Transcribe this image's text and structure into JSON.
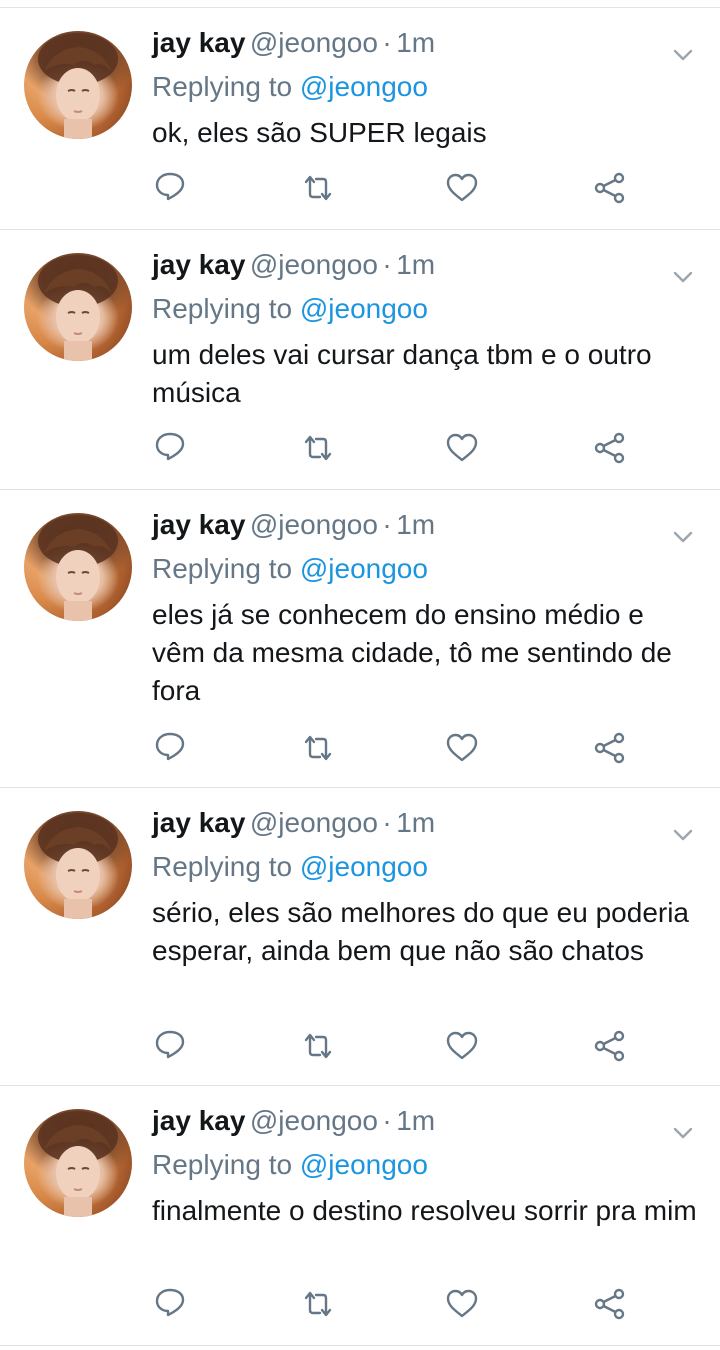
{
  "tweets": [
    {
      "author_name": "jay kay",
      "author_handle": "@jeongoo",
      "separator": "·",
      "time": "1m",
      "reply_prefix": "Replying to",
      "reply_mention": "@jeongoo",
      "text": "ok, eles são SUPER legais"
    },
    {
      "author_name": "jay kay",
      "author_handle": "@jeongoo",
      "separator": "·",
      "time": "1m",
      "reply_prefix": "Replying to",
      "reply_mention": "@jeongoo",
      "text": "um deles vai cursar dança tbm e o outro música"
    },
    {
      "author_name": "jay kay",
      "author_handle": "@jeongoo",
      "separator": "·",
      "time": "1m",
      "reply_prefix": "Replying to",
      "reply_mention": "@jeongoo",
      "text": "eles já se conhecem do ensino médio e vêm da mesma cidade, tô me sentindo de fora"
    },
    {
      "author_name": "jay kay",
      "author_handle": "@jeongoo",
      "separator": "·",
      "time": "1m",
      "reply_prefix": "Replying to",
      "reply_mention": "@jeongoo",
      "text": "sério, eles são melhores do que eu poderia esperar, ainda bem que não são chatos"
    },
    {
      "author_name": "jay kay",
      "author_handle": "@jeongoo",
      "separator": "·",
      "time": "1m",
      "reply_prefix": "Replying to",
      "reply_mention": "@jeongoo",
      "text": "finalmente o destino resolveu sorrir pra mim"
    }
  ],
  "icons": {
    "reply": "reply-icon",
    "retweet": "retweet-icon",
    "like": "like-icon",
    "share": "share-icon",
    "more": "chevron-down-icon"
  },
  "colors": {
    "name": "#14171a",
    "muted": "#657786",
    "link": "#1b95e0",
    "divider": "#dfe4e8"
  }
}
